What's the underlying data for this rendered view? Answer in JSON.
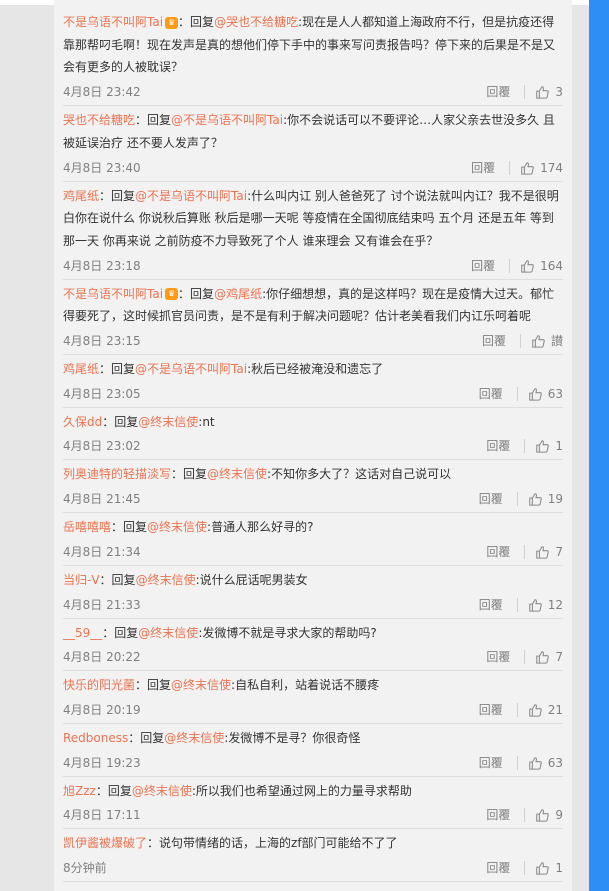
{
  "comments": [
    {
      "user": "不是乌语不叫阿Tai",
      "vip": true,
      "prefix": "：回复",
      "mention": "@哭也不给糖吃",
      "text": ":现在是人人都知道上海政府不行，但是抗疫还得靠那帮叼毛啊！现在发声是真的想他们停下手中的事来写问责报告吗？停下来的后果是不是又会有更多的人被耽误？",
      "time": "4月8日 23:42",
      "reply": "回覆",
      "likes": "3"
    },
    {
      "user": "哭也不给糖吃",
      "vip": false,
      "prefix": "：回复",
      "mention": "@不是乌语不叫阿Tai",
      "text": ":你不会说话可以不要评论…人家父亲去世没多久 且被延误治疗 还不要人发声了？",
      "time": "4月8日 23:40",
      "reply": "回覆",
      "likes": "174"
    },
    {
      "user": "鸡尾纸",
      "vip": false,
      "prefix": "：回复",
      "mention": "@不是乌语不叫阿Tai",
      "text": ":什么叫内讧 别人爸爸死了 讨个说法就叫内讧？我不是很明白你在说什么 你说秋后算账 秋后是哪一天呢 等疫情在全国彻底结束吗 五个月 还是五年 等到那一天 你再来说 之前防疫不力导致死了个人 谁来理会 又有谁会在乎？",
      "time": "4月8日 23:18",
      "reply": "回覆",
      "likes": "164"
    },
    {
      "user": "不是乌语不叫阿Tai",
      "vip": true,
      "prefix": "：回复",
      "mention": "@鸡尾纸",
      "text": ":你仔细想想，真的是这样吗？现在是疫情大过天。郁忙得要死了，这时候抓官员问责，是不是有利于解决问题呢？估计老美看我们内讧乐呵着呢",
      "time": "4月8日 23:15",
      "reply": "回覆",
      "likes": "讃"
    },
    {
      "user": "鸡尾纸",
      "vip": false,
      "prefix": "：回复",
      "mention": "@不是乌语不叫阿Tai",
      "text": ":秋后已经被淹没和遗忘了",
      "time": "4月8日 23:05",
      "reply": "回覆",
      "likes": "63"
    },
    {
      "user": "久保dd",
      "vip": false,
      "prefix": "：回复",
      "mention": "@终末信使",
      "text": ":nt",
      "time": "4月8日 23:02",
      "reply": "回覆",
      "likes": "1"
    },
    {
      "user": "列奥迪特的轻描淡写",
      "vip": false,
      "prefix": "：回复",
      "mention": "@终末信使",
      "text": ":不知你多大了？这话对自己说可以",
      "time": "4月8日 21:45",
      "reply": "回覆",
      "likes": "19"
    },
    {
      "user": "岳嘻嘻嘻",
      "vip": false,
      "prefix": "：回复",
      "mention": "@终末信使",
      "text": ":普通人那么好寻的?",
      "time": "4月8日 21:34",
      "reply": "回覆",
      "likes": "7"
    },
    {
      "user": "当归-V",
      "vip": false,
      "prefix": "：回复",
      "mention": "@终末信使",
      "text": ":说什么屁话呢男装女",
      "time": "4月8日 21:33",
      "reply": "回覆",
      "likes": "12"
    },
    {
      "user": "__59__",
      "vip": false,
      "prefix": "：回复",
      "mention": "@终末信使",
      "text": ":发微博不就是寻求大家的帮助吗?",
      "time": "4月8日 20:22",
      "reply": "回覆",
      "likes": "7"
    },
    {
      "user": "快乐的阳光菌",
      "vip": false,
      "prefix": "：回复",
      "mention": "@终末信使",
      "text": ":自私自利，站着说话不腰疼",
      "time": "4月8日 20:19",
      "reply": "回覆",
      "likes": "21"
    },
    {
      "user": "Redboness",
      "vip": false,
      "prefix": "：回复",
      "mention": "@终末信使",
      "text": ":发微博不是寻？你很奇怪",
      "time": "4月8日 19:23",
      "reply": "回覆",
      "likes": "63"
    },
    {
      "user": "旭Zzz",
      "vip": false,
      "prefix": "：回复",
      "mention": "@终末信使",
      "text": ":所以我们也希望通过网上的力量寻求帮助",
      "time": "4月8日 17:11",
      "reply": "回覆",
      "likes": "9"
    },
    {
      "user": "凯伊酱被爆破了",
      "vip": false,
      "prefix": "：",
      "mention": "",
      "text": "说句带情绪的话，上海的zf部门可能给不了了",
      "time": "8分钟前",
      "reply": "回覆",
      "likes": "1"
    }
  ],
  "icons": {
    "vip_badge": "crown-badge-icon",
    "like": "thumbs-up-icon"
  },
  "colors": {
    "username": "#eb7350",
    "panel": "#f2f2f2",
    "scrollbar": "#2f8ef5"
  }
}
